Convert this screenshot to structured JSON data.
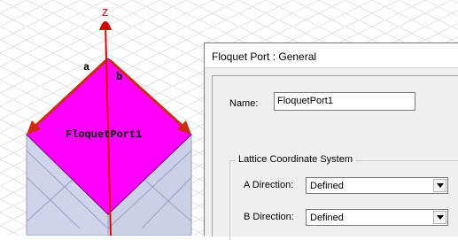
{
  "viewport": {
    "axis_label": "Z",
    "edge_a_label": "a",
    "edge_b_label": "b",
    "port_label": "FloquetPort1",
    "colors": {
      "port_face": "#ff00ff",
      "arrow": "#cc2a12",
      "axis": "#e00000",
      "box": "#cfd4ea"
    }
  },
  "dialog": {
    "title": "Floquet Port : General",
    "name_label": "Name:",
    "name_value": "FloquetPort1",
    "group_label": "Lattice Coordinate System",
    "a_direction_label": "A  Direction:",
    "a_direction_value": "Defined",
    "b_direction_label": "B  Direction:",
    "b_direction_value": "Defined"
  }
}
